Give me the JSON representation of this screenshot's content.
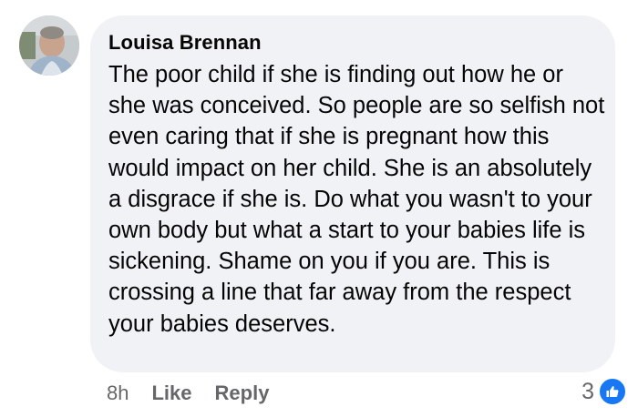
{
  "comment": {
    "author": "Louisa Brennan",
    "text": "The poor child if she is finding out how he or she was conceived. So people are so selfish not even caring that if she is pregnant how this would impact on her child. She is an absolutely a disgrace if she is. Do what you wasn't to your own body but what a start to your babies life is sickening. Shame on you if you are. This is crossing a line that far away from the respect your babies deserves.",
    "timestamp": "8h",
    "like_label": "Like",
    "reply_label": "Reply",
    "reaction_count": "3",
    "reaction_icon": "thumbs-up-icon"
  },
  "colors": {
    "bubble_bg": "#f0f2f5",
    "text": "#050505",
    "meta": "#65676b",
    "like_blue": "#1877f2"
  }
}
